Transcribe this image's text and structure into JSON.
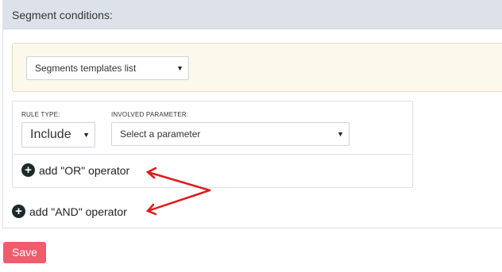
{
  "panel": {
    "header_title": "Segment conditions:"
  },
  "templates": {
    "select_value": "Segments templates list"
  },
  "rule": {
    "rule_type_label": "RULE TYPE:",
    "rule_type_value": "Include",
    "param_label": "INVOLVED PARAMETER:",
    "param_value": "Select a parameter"
  },
  "operators": {
    "or_label": "add \"OR\" operator",
    "and_label": "add \"AND\" operator"
  },
  "actions": {
    "save_label": "Save"
  },
  "icons": {
    "plus": "plus-circle-icon",
    "caret": "caret-down-icon",
    "annotation": "red-arrow"
  },
  "colors": {
    "header_bg": "#dde2ea",
    "templates_bg": "#fcf8ec",
    "save_bg": "#f05c6c",
    "arrow": "#e0191b"
  }
}
